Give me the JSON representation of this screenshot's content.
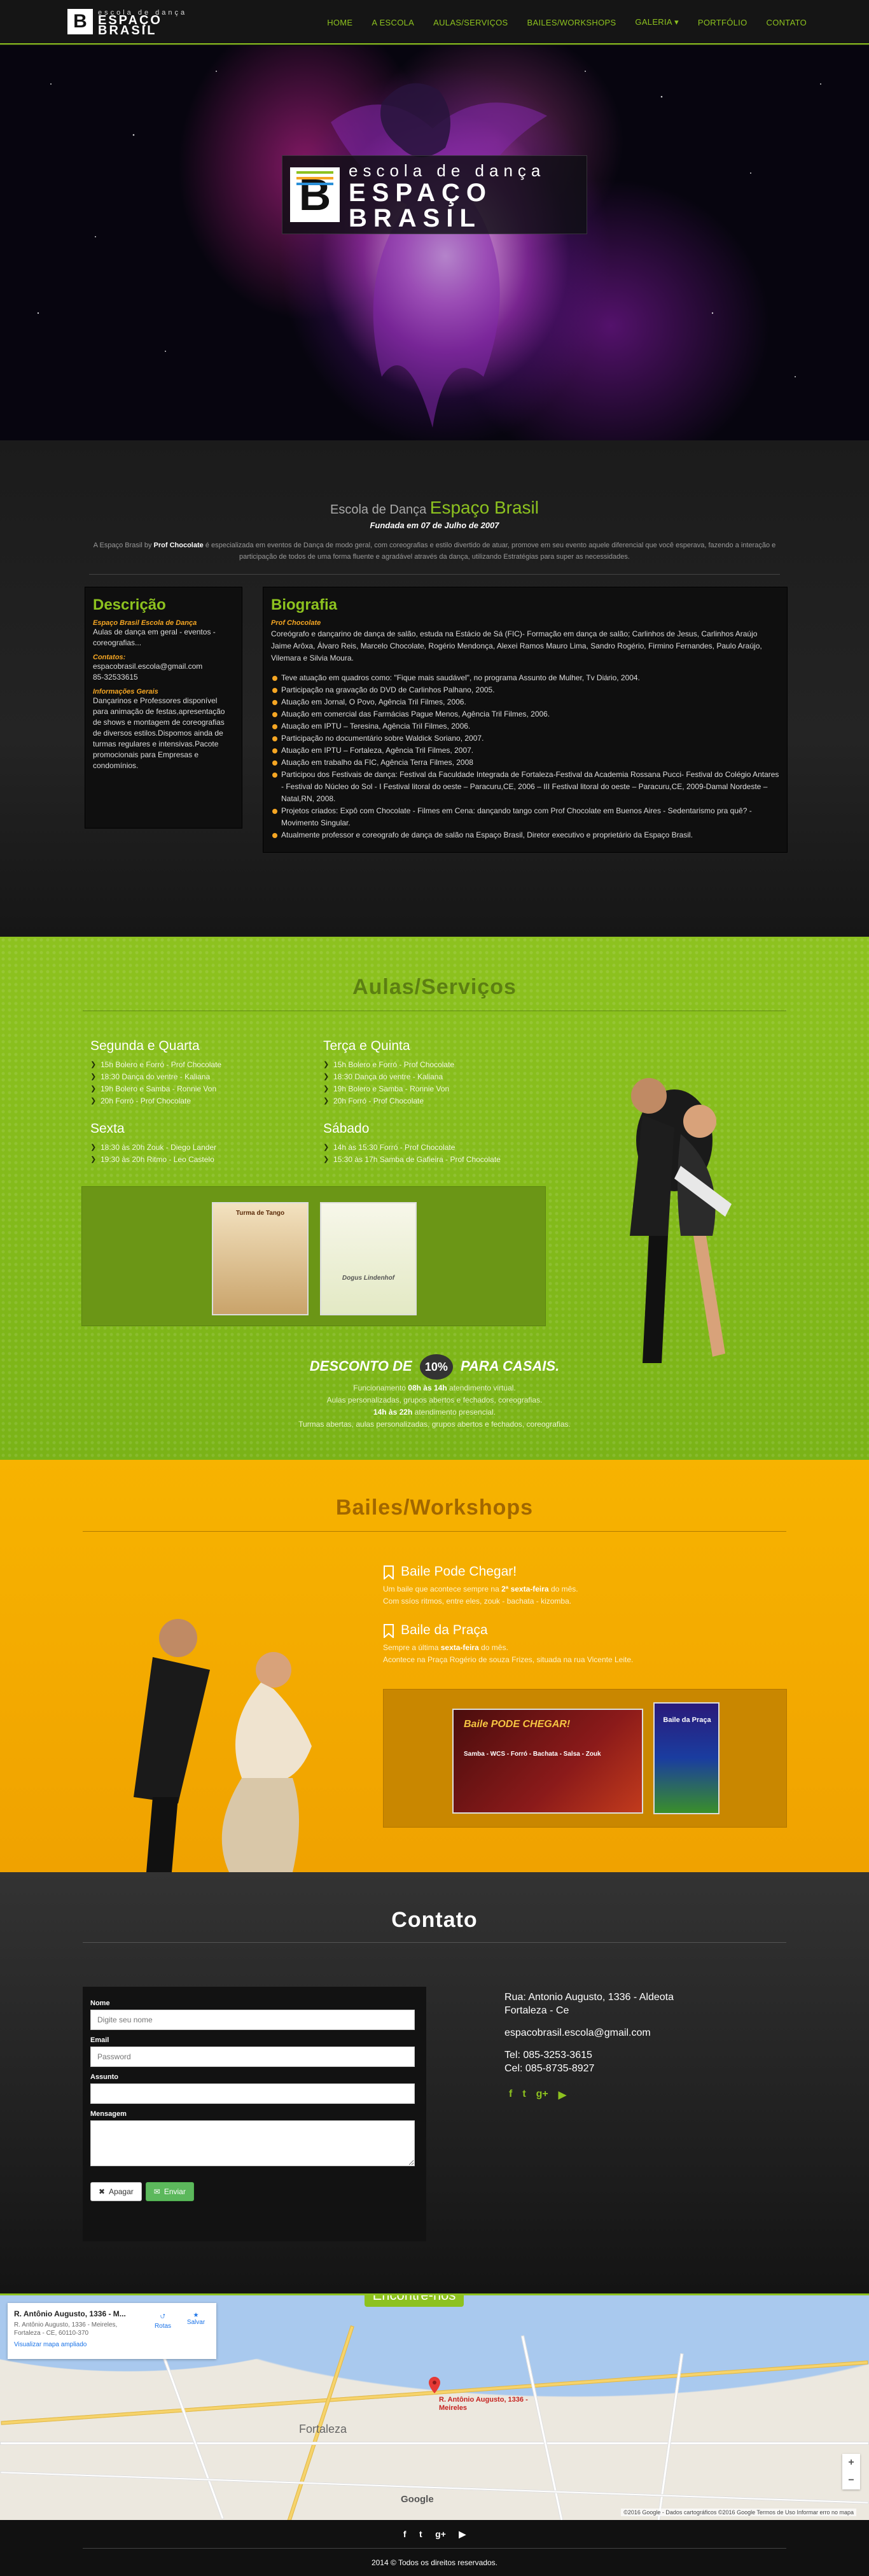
{
  "nav": {
    "logo": {
      "letter": "B",
      "top": "escola de dança",
      "line1": "ESPAÇO",
      "line2": "BRASIL"
    },
    "menu": [
      "HOME",
      "A ESCOLA",
      "AULAS/SERVIÇOS",
      "BAILES/WORKSHOPS",
      "GALERIA ▾",
      "PORTFÓLIO",
      "CONTATO"
    ],
    "accent": "#8dc21f"
  },
  "hero": {
    "logo_top": "escola de dança",
    "logo_line1": "ESPAÇO",
    "logo_line2": "BRASIL"
  },
  "about": {
    "title_pre": "Escola de Dança",
    "title_brand": "Espaço Brasil",
    "founded": "Fundada em 07 de Julho de 2007",
    "text_pre": "A Espaço Brasil by",
    "text_bold": "Prof Chocolate",
    "text_post": "é especializada em eventos de Dança de modo geral, com coreografias e estilo divertido de atuar, promove em seu evento aquele diferencial que você esperava, fazendo a interação e participação de todos de uma forma fluente e agradável através da dança, utilizando Estratégias para super as necessidades."
  },
  "descricao": {
    "title": "Descrição",
    "label1": "Espaço Brasil Escola de Dança",
    "value1": "Aulas de dança em geral - eventos - coreografias...",
    "label2": "Contatos:",
    "value2a": "espacobrasil.escola@gmail.com",
    "value2b": "85-32533615",
    "label3": "Informações Gerais",
    "value3": "Dançarinos e Professores disponível para animação de festas,apresentação de shows e montagem de coreografias de diversos estilos.Dispomos ainda de turmas regulares e intensivas.Pacote promocionais para Empresas e condomínios."
  },
  "biografia": {
    "title": "Biografia",
    "label": "Prof Chocolate",
    "intro": "Coreógrafo e dançarino de dança de salão, estuda na Estácio de Sá (FIC)- Formação em dança de salão; Carlinhos de Jesus, Carlinhos Araújo Jaime Arôxa, Álvaro Reis, Marcelo Chocolate, Rogério Mendonça, Alexei Ramos Mauro Lima, Sandro Rogério, Firmino Fernandes, Paulo Araújo, Vilemara e Silvia Moura.",
    "items": [
      "Teve atuação em quadros como: \"Fique mais saudável\", no programa Assunto de Mulher, Tv Diário, 2004.",
      "Participação na gravação do DVD de Carlinhos Palhano, 2005.",
      "Atuação em Jornal, O Povo, Agência Tril Filmes, 2006.",
      "Atuação em comercial das Farmácias Pague Menos, Agência Tril Filmes, 2006.",
      "Atuação em IPTU – Teresina, Agência Tril Filmes, 2006.",
      "Participação no documentário sobre Waldick Soriano, 2007.",
      "Atuação em IPTU – Fortaleza, Agência Tril Filmes, 2007.",
      "Atuação em trabalho da FIC, Agência Terra Filmes, 2008",
      "Participou dos Festivais de dança: Festival da Faculdade Integrada de Fortaleza-Festival da Academia Rossana Pucci- Festival do Colégio Antares - Festival do Núcleo do Sol - I Festival litoral do oeste – Paracuru,CE, 2006 – III Festival litoral do oeste – Paracuru,CE, 2009-Damal Nordeste – Natal,RN, 2008.",
      "Projetos criados: Expô com Chocolate - Filmes em Cena: dançando tango com Prof Chocolate em Buenos Aires - Sedentarismo pra quê? - Movimento Singular.",
      "Atualmente professor e coreografo de dança de salão na Espaço Brasil, Diretor executivo e proprietário da Espaço Brasil."
    ],
    "bullet_color": "#f5a623"
  },
  "aulas": {
    "title": "Aulas/Serviços",
    "days": [
      {
        "name": "Segunda e Quarta",
        "items": [
          "15h Bolero e Forró - Prof Chocolate",
          "18:30 Dança do ventre - Kaliana",
          "19h Bolero e Samba - Ronnie Von",
          "20h Forró - Prof Chocolate"
        ]
      },
      {
        "name": "Terça e Quinta",
        "items": [
          "15h Bolero e Forró - Prof Chocolate",
          "18:30 Dança do ventre - Kaliana",
          "19h Bolero e Samba - Ronnie Von",
          "20h Forró - Prof Chocolate"
        ]
      },
      {
        "name": "Sexta",
        "items": [
          "18:30 às 20h Zouk - Diego Lander",
          "19:30 às 20h Ritmo - Leo Castelo"
        ]
      },
      {
        "name": "Sábado",
        "items": [
          "14h às 15:30 Forró - Prof Chocolate",
          "15:30 às 17h Samba de Gafieira - Prof Chocolate"
        ]
      }
    ],
    "flyer1": "Turma de Tango",
    "flyer2": "Dogus Lindenhof",
    "discount_pre": "DESCONTO DE",
    "discount_badge": "10%",
    "discount_post": "PARA CASAIS.",
    "info": [
      [
        "Funcionamento",
        "08h às 14h",
        "atendimento virtual."
      ],
      [
        "Aulas personalizadas, grupos abertos e fechados, coreografias.",
        "",
        ""
      ],
      [
        "",
        "14h às 22h",
        "atendimento presencial."
      ],
      [
        "Turmas abertas, aulas personalizadas, grupos abertos e fechados, coreografias.",
        "",
        ""
      ]
    ]
  },
  "bailes": {
    "title": "Bailes/Workshops",
    "event1": {
      "name": "Baile Pode Chegar!",
      "text_pre": "Um baile que acontece sempre na",
      "text_bold": "2ª sexta-feira",
      "text_post": "do mês.",
      "text2": "Com ssíos ritmos, entre eles, zouk - bachata - kizomba."
    },
    "event2": {
      "name": "Baile da Praça",
      "text_pre": "Sempre a última",
      "text_bold": "sexta-feira",
      "text_post": "do mês.",
      "text2": "Acontece na Praça Rogério de souza Frizes, situada na rua Vicente Leite."
    },
    "flyer1_title": "Baile PODE CHEGAR!",
    "flyer1_sub": "Samba - WCS - Forró - Bachata - Salsa - Zouk",
    "flyer2_title": "Baile da Praça"
  },
  "contato": {
    "title": "Contato",
    "form": {
      "name_label": "Nome",
      "name_ph": "Digite seu nome",
      "email_label": "Email",
      "email_ph": "Password",
      "subject_label": "Assunto",
      "message_label": "Mensagem",
      "clear": "Apagar",
      "send": "Enviar"
    },
    "address1": "Rua: Antonio Augusto, 1336 - Aldeota",
    "address2": "Fortaleza - Ce",
    "email": "espacobrasil.escola@gmail.com",
    "tel": "Tel: 085-3253-3615",
    "cel": "Cel: 085-8735-8927",
    "social": [
      "f",
      "t",
      "g+",
      "▶"
    ]
  },
  "map": {
    "badge": "Encontre-nos",
    "card_title": "R. Antônio Augusto, 1336 - M...",
    "card_addr": "R. Antônio Augusto, 1336 - Meireles, Fortaleza - CE, 60110-370",
    "card_link": "Visualizar mapa ampliado",
    "act1": "Rotas",
    "act2": "Salvar",
    "pin_label": "R. Antônio Augusto, 1336 - Meireles",
    "city": "Fortaleza",
    "google": "Google",
    "copy": "©2016 Google - Dados cartográficos ©2016 Google   Termos de Uso   Informar erro no mapa"
  },
  "footer": {
    "social": [
      "f",
      "t",
      "g+",
      "▶"
    ],
    "copy": "2014 © Todos os direitos reservados."
  }
}
